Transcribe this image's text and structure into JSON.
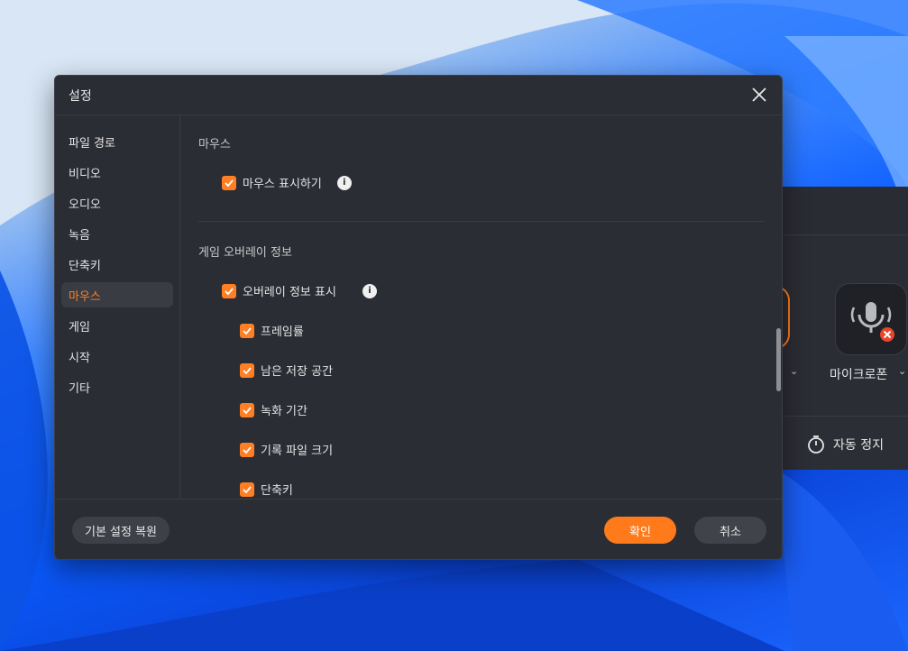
{
  "dialog": {
    "title": "설정",
    "close_icon": "close-icon"
  },
  "sidebar": {
    "items": [
      {
        "label": "파일 경로"
      },
      {
        "label": "비디오"
      },
      {
        "label": "오디오"
      },
      {
        "label": "녹음"
      },
      {
        "label": "단축키"
      },
      {
        "label": "마우스",
        "active": true
      },
      {
        "label": "게임"
      },
      {
        "label": "시작"
      },
      {
        "label": "기타"
      }
    ]
  },
  "content": {
    "mouse_section": {
      "title": "마우스",
      "show_mouse": {
        "label": "마우스 표시하기",
        "checked": true
      }
    },
    "overlay_section": {
      "title": "게임 오버레이 정보",
      "show_overlay": {
        "label": "오버레이 정보 표시",
        "checked": true
      },
      "options": [
        {
          "label": "프레임률",
          "checked": true
        },
        {
          "label": "남은 저장 공간",
          "checked": true
        },
        {
          "label": "녹화 기간",
          "checked": true
        },
        {
          "label": "기록 파일 크기",
          "checked": true
        },
        {
          "label": "단축키",
          "checked": true
        }
      ]
    }
  },
  "footer": {
    "reset_label": "기본 설정 복원",
    "ok_label": "확인",
    "cancel_label": "취소"
  },
  "background_app": {
    "mic_label": "마이크로폰",
    "auto_stop_label": "자동 정지"
  },
  "colors": {
    "accent": "#ff7a1a",
    "dialog_bg": "#2b2d34",
    "mic_error": "#e8452c"
  }
}
